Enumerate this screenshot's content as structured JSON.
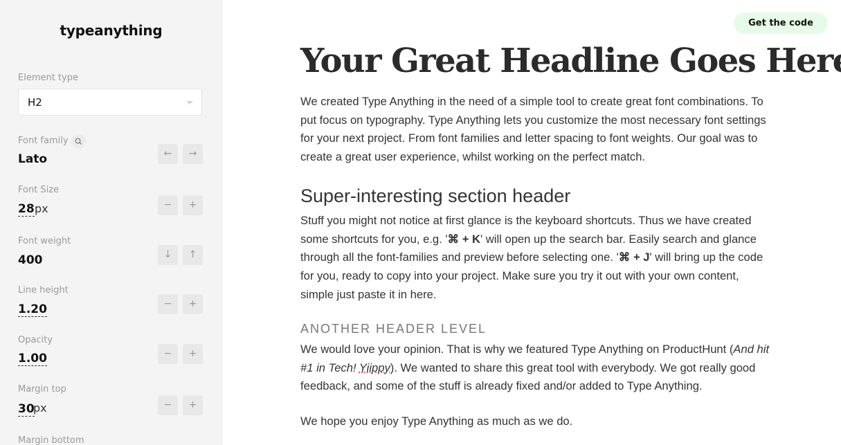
{
  "app": {
    "logo": "typeanything"
  },
  "header": {
    "get_code_label": "Get the code"
  },
  "sidebar": {
    "element_type": {
      "label": "Element type",
      "value": "H2"
    },
    "font_family": {
      "label": "Font family",
      "value": "Lato",
      "prev": "←",
      "next": "→"
    },
    "font_size": {
      "label": "Font Size",
      "value": "28",
      "unit": "px",
      "dec": "−",
      "inc": "+"
    },
    "font_weight": {
      "label": "Font weight",
      "value": "400",
      "dec": "↓",
      "inc": "↑"
    },
    "line_height": {
      "label": "Line height",
      "value": "1.20",
      "dec": "−",
      "inc": "+"
    },
    "opacity": {
      "label": "Opacity",
      "value": "1.00",
      "dec": "−",
      "inc": "+"
    },
    "margin_top": {
      "label": "Margin top",
      "value": "30",
      "unit": "px",
      "dec": "−",
      "inc": "+"
    },
    "margin_bottom": {
      "label": "Margin bottom"
    }
  },
  "preview": {
    "headline": "Your Great Headline Goes Here",
    "intro": "We created Type Anything in the need of a simple tool to create great font combinations. To put focus on typography. Type Anything lets you customize the most necessary font settings for your next project. From font families and letter spacing to font weights. Our goal was to create a great user experience, whilst working on the perfect match.",
    "section_header": "Super-interesting section header",
    "section_body": {
      "part1": "Stuff you might not notice at first glance is the keyboard shortcuts. Thus we have created some shortcuts for you, e.g. '",
      "shortcut1": "⌘ + K",
      "part2": "' will open up the search bar. Easily search and glance through all the font-families and preview before selecting one. '",
      "shortcut2": "⌘ + J",
      "part3": "' will bring up the code for you, ready to copy into your project. Make sure you try it out with your own content, simple just paste it in here."
    },
    "sub_header": "ANOTHER HEADER LEVEL",
    "opinion": {
      "part1": "We would love your opinion. That is why we featured Type Anything on ProductHunt (",
      "italic1": "And hit #1 in Tech! ",
      "italic2": "Yiippy",
      "part2": "). We wanted to share this great tool with everybody. We got really good feedback, and some of the stuff is already fixed and/or added to Type Anything."
    },
    "closing": "We hope you enjoy Type Anything as much as we do."
  }
}
